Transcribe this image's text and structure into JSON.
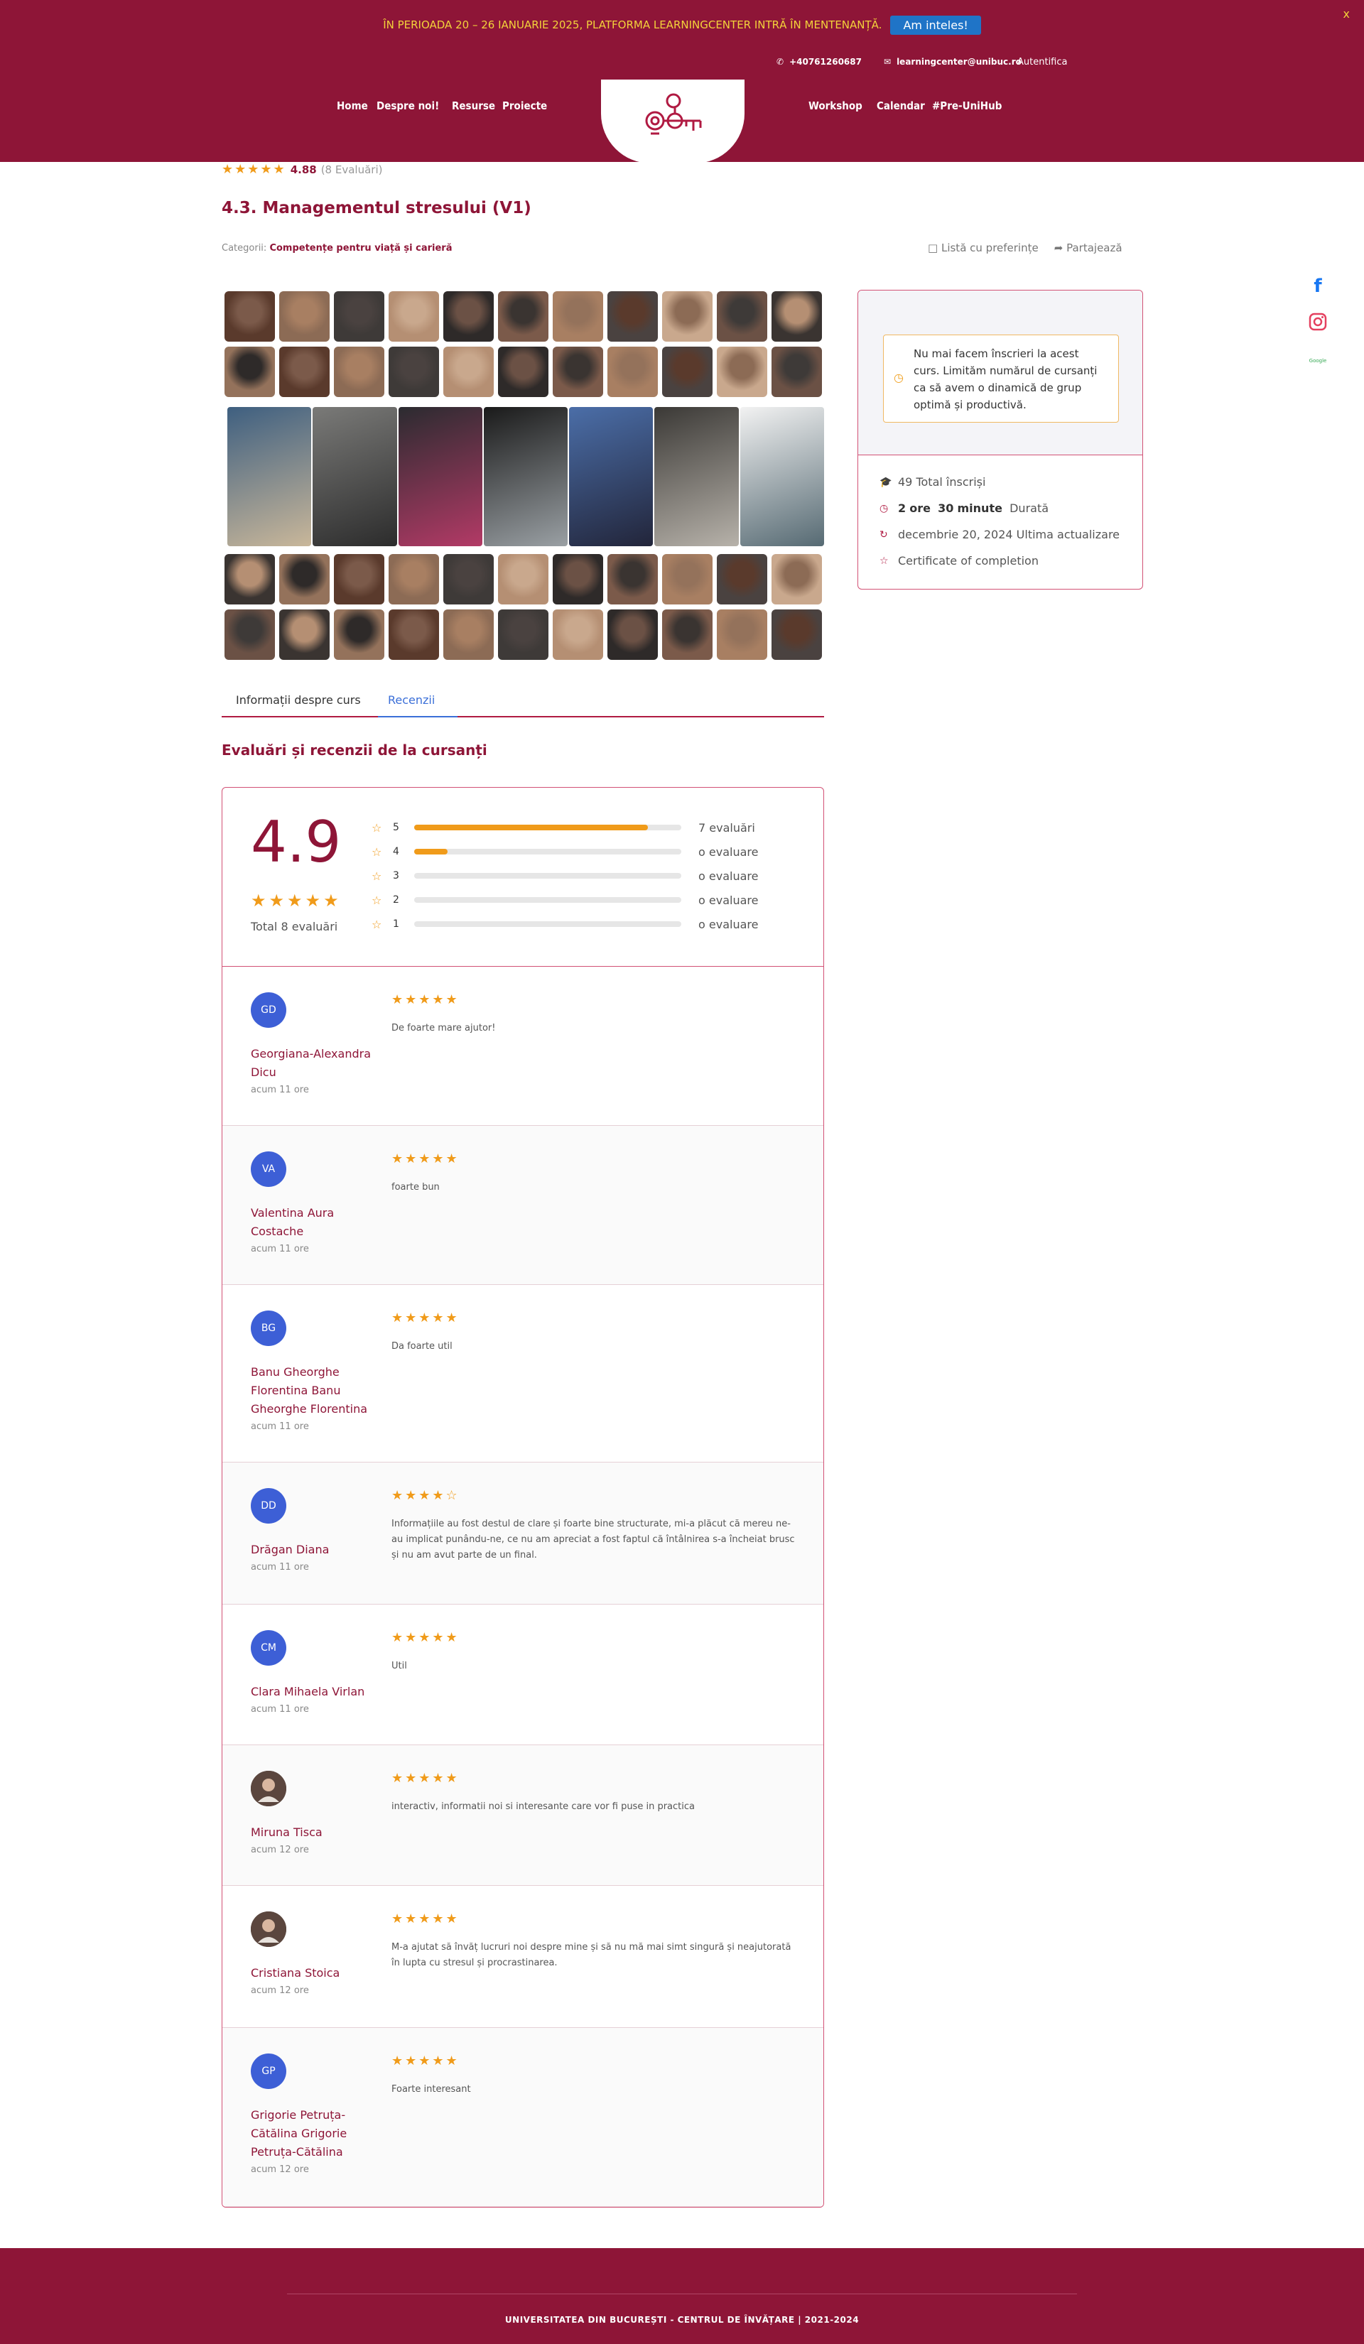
{
  "notice": {
    "text": "ÎN PERIOADA 20 – 26 IANUARIE 2025, PLATFORMA LEARNINGCENTER INTRĂ ÎN MENTENANȚĂ.",
    "button": "Am inteles!",
    "close": "x"
  },
  "topbar": {
    "phone": "+40761260687",
    "email": "learningcenter@unibuc.ro",
    "login": "Autentifica"
  },
  "nav": {
    "home": "Home",
    "about": "Despre noi!",
    "resources": "Resurse",
    "projects": "Proiecte",
    "workshop": "Workshop",
    "calendar": "Calendar",
    "preunihub": "#Pre-UniHub"
  },
  "course": {
    "rating_value": "4.88",
    "rating_count": "(8 Evaluări)",
    "title": "4.3. Managementul stresului (V1)",
    "category_label": "Categorii:",
    "category_value": "Competențe pentru viață și carieră",
    "wishlist": "Listă cu preferințe",
    "share": "Partajează"
  },
  "tabs": {
    "info": "Informații despre curs",
    "reviews": "Recenzii"
  },
  "reviews_section": {
    "title": "Evaluări și recenzii de la cursanți",
    "big_score": "4.9",
    "total": "Total 8 evaluări",
    "distribution": [
      {
        "stars": "5",
        "label": "7 evaluări",
        "fraction": 0.875
      },
      {
        "stars": "4",
        "label": "o evaluare",
        "fraction": 0.125
      },
      {
        "stars": "3",
        "label": "o evaluare",
        "fraction": 0
      },
      {
        "stars": "2",
        "label": "o evaluare",
        "fraction": 0
      },
      {
        "stars": "1",
        "label": "o evaluare",
        "fraction": 0
      }
    ],
    "reviews": [
      {
        "initials": "GD",
        "name": "Georgiana-Alexandra Dicu",
        "time": "acum 11 ore",
        "rating": 5,
        "text": "De foarte mare ajutor!"
      },
      {
        "initials": "VA",
        "name": "Valentina Aura Costache",
        "time": "acum 11 ore",
        "rating": 5,
        "text": "foarte bun"
      },
      {
        "initials": "BG",
        "name": "Banu Gheorghe Florentina Banu Gheorghe Florentina",
        "time": "acum 11 ore",
        "rating": 5,
        "text": "Da foarte util"
      },
      {
        "initials": "DD",
        "name": "Drăgan Diana",
        "time": "acum 11 ore",
        "rating": 4,
        "text": "Informațiile au fost destul de clare și foarte bine structurate, mi-a plăcut că mereu ne-au implicat punându-ne, ce nu am apreciat a fost faptul că întâlnirea s-a încheiat brusc și nu am avut parte de un final."
      },
      {
        "initials": "CM",
        "name": "Clara Mihaela Virlan",
        "time": "acum 11 ore",
        "rating": 5,
        "text": "Util"
      },
      {
        "initials": "",
        "name": "Miruna Tisca",
        "time": "acum 12 ore",
        "rating": 5,
        "text": "interactiv, informatii noi si interesante care vor fi puse in practica"
      },
      {
        "initials": "",
        "name": "Cristiana Stoica",
        "time": "acum 12 ore",
        "rating": 5,
        "text": "M-a ajutat să învăț lucruri noi despre mine și să nu mă mai simt singură și neajutorată în lupta cu stresul și procrastinarea."
      },
      {
        "initials": "GP",
        "name": "Grigorie Petruța-Cătălina Grigorie Petruța-Cătălina",
        "time": "acum 12 ore",
        "rating": 5,
        "text": "Foarte interesant"
      }
    ]
  },
  "sidebar": {
    "alert": "Nu mai facem înscrieri la acest curs. Limităm numărul de cursanți ca să avem o dinamică de grup optimă și productivă.",
    "enrolled": "49 Total înscriși",
    "duration_hours": "2",
    "duration_hours_unit": "ore",
    "duration_minutes": "30",
    "duration_minutes_unit": "minute",
    "duration_label": "Durată",
    "updated": "decembrie 20, 2024 Ultima actualizare",
    "certificate": "Certificate of completion"
  },
  "social": {
    "facebook": "f",
    "google": "Google"
  },
  "footer": {
    "text": "UNIVERSITATEA DIN BUCUREȘTI - CENTRUL DE ÎNVĂȚARE | 2021-2024"
  },
  "colors": {
    "brand": "#8e1537",
    "accent_star": "#f09b1a",
    "avatar": "#3d5fd6",
    "tab_active": "#3b6fd8"
  }
}
